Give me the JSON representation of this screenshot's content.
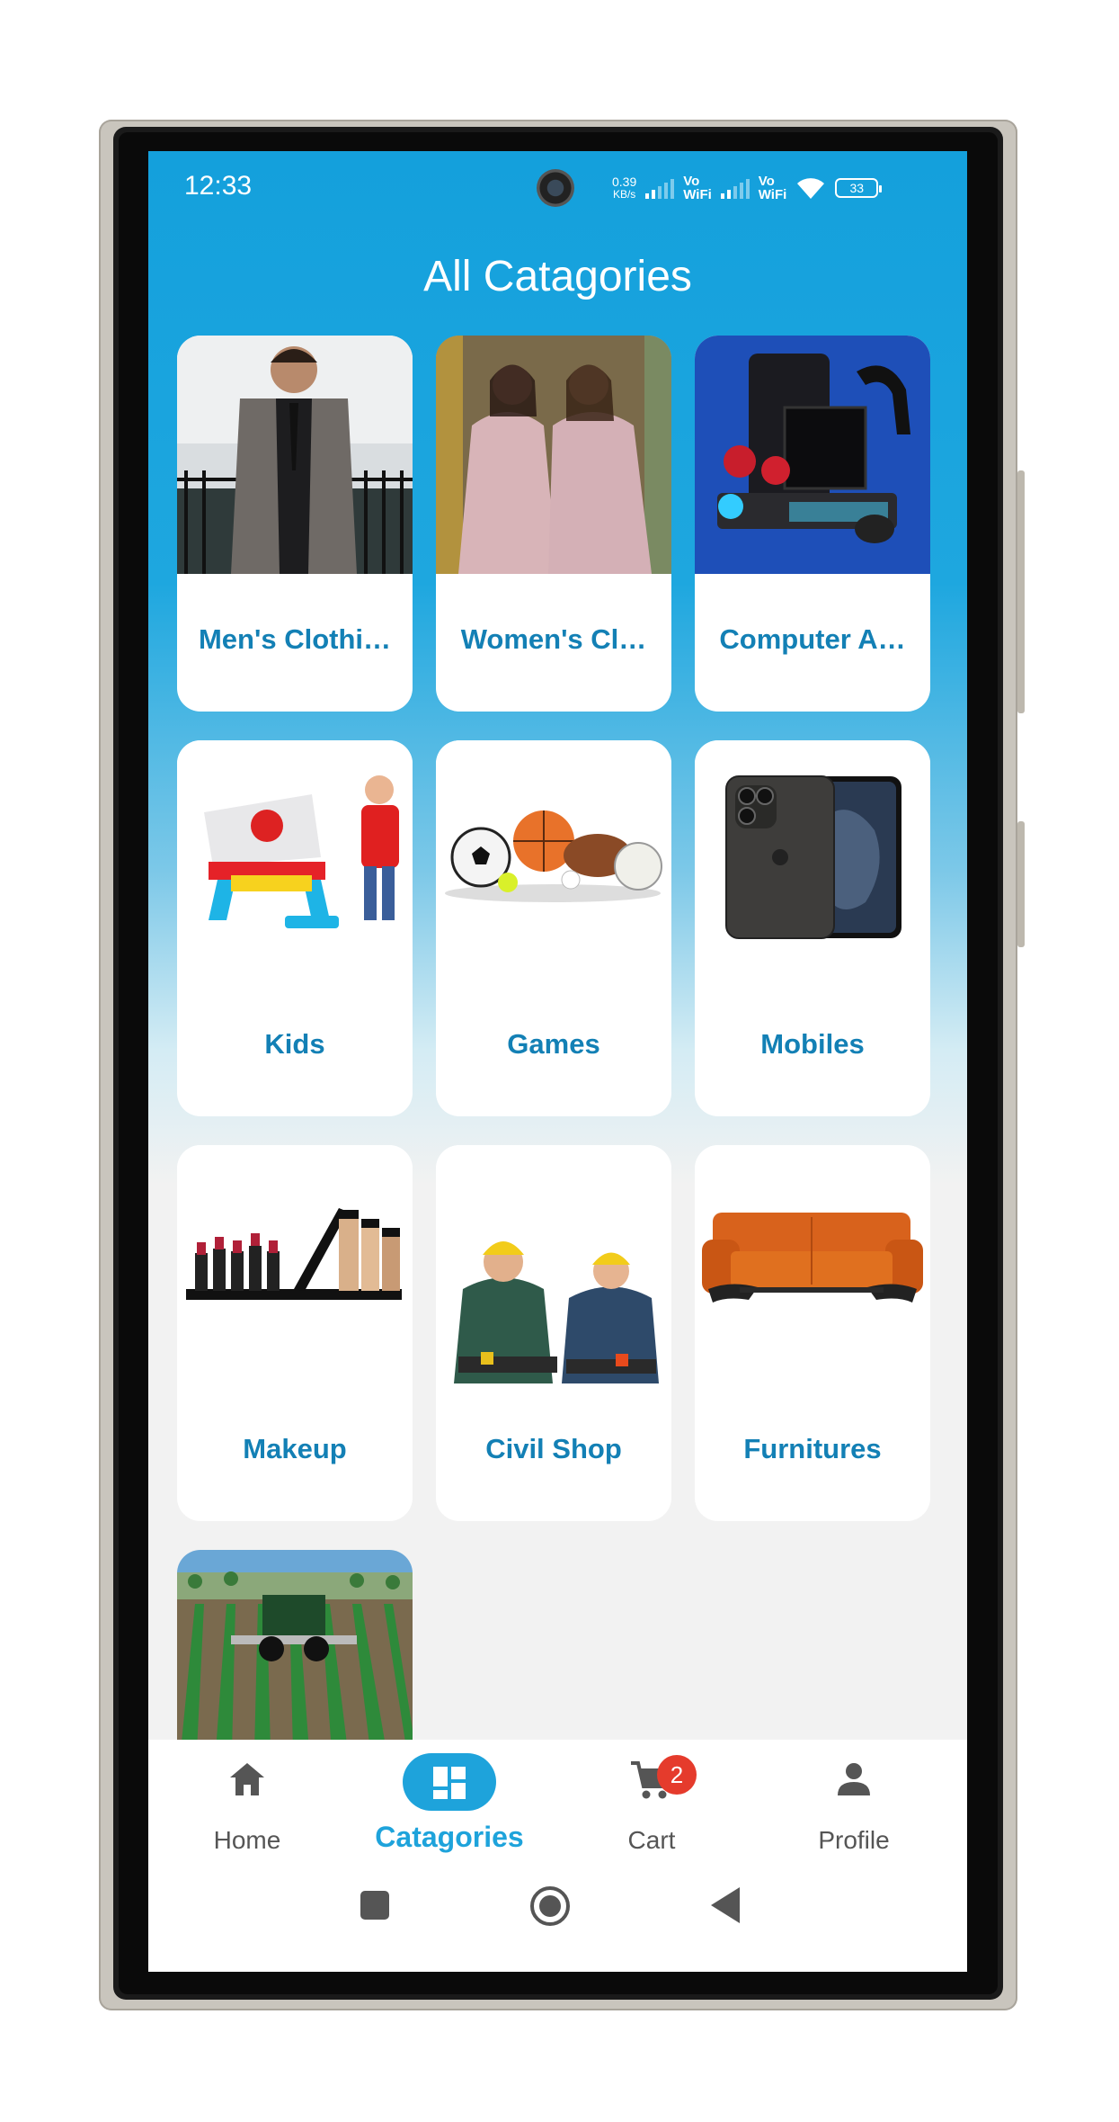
{
  "status_bar": {
    "time": "12:33",
    "net_speed_value": "0.39",
    "net_speed_unit": "KB/s",
    "vowifi_1_line1": "Vo",
    "vowifi_1_line2": "WiFi",
    "vowifi_2_line1": "Vo",
    "vowifi_2_line2": "WiFi",
    "battery": "33"
  },
  "page": {
    "title": "All Catagories"
  },
  "categories": [
    {
      "label": "Men's Clothi…",
      "image": "mens-clothing-photo"
    },
    {
      "label": "Women's Cl…",
      "image": "womens-clothing-photo"
    },
    {
      "label": "Computer A…",
      "image": "computer-accessories-photo"
    },
    {
      "label": "Kids",
      "image": "kids-photo"
    },
    {
      "label": "Games",
      "image": "games-balls-photo"
    },
    {
      "label": "Mobiles",
      "image": "mobile-phone-photo"
    },
    {
      "label": "Makeup",
      "image": "makeup-photo"
    },
    {
      "label": "Civil Shop",
      "image": "civil-workers-photo"
    },
    {
      "label": "Furnitures",
      "image": "sofa-photo"
    },
    {
      "label": "",
      "image": "agriculture-tractor-photo"
    }
  ],
  "bottom_nav": {
    "items": [
      {
        "label": "Home",
        "icon": "home-icon"
      },
      {
        "label": "Catagories",
        "icon": "grid-icon",
        "active": true
      },
      {
        "label": "Cart",
        "icon": "cart-icon",
        "badge": "2"
      },
      {
        "label": "Profile",
        "icon": "person-icon"
      }
    ]
  },
  "colors": {
    "accent": "#1ea3db",
    "label_text": "#1380b5",
    "badge": "#e53b2c"
  }
}
